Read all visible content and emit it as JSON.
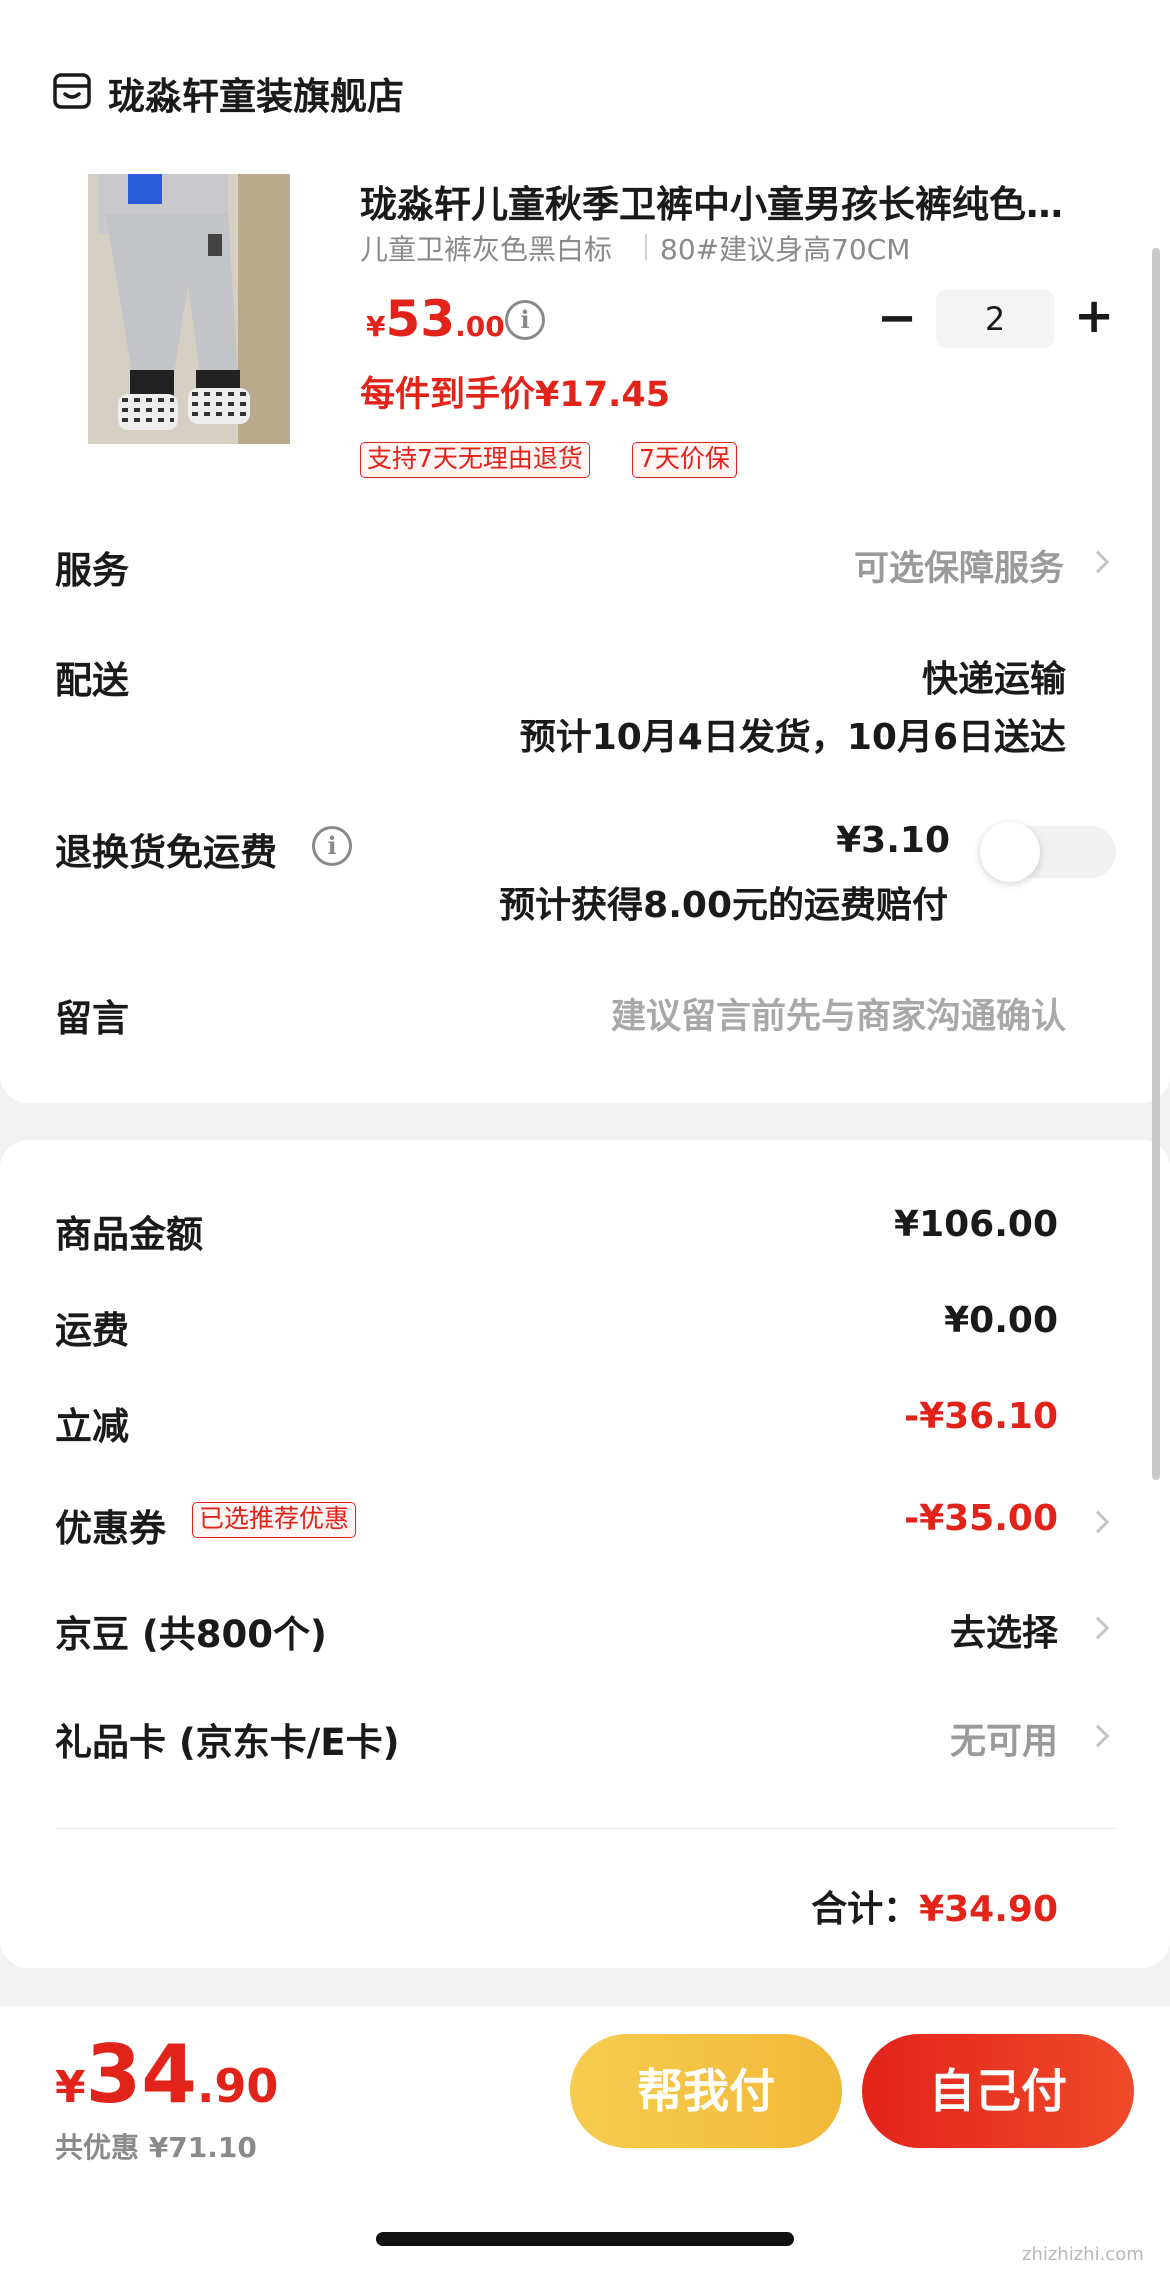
{
  "store": {
    "icon": "store-icon",
    "name": "珑淼轩童装旗舰店"
  },
  "product": {
    "title": "珑淼轩儿童秋季卫裤中小童男孩长裤纯色…",
    "spec_color": "儿童卫裤灰色黑白标",
    "spec_size": "80#建议身高70CM",
    "price_symbol": "¥",
    "price_int": "53",
    "price_dec": ".00",
    "unit_price": "每件到手价¥17.45",
    "quantity": "2",
    "minus": "−",
    "plus": "+",
    "tags": [
      "支持7天无理由退货",
      "7天价保"
    ]
  },
  "service": {
    "label": "服务",
    "value": "可选保障服务"
  },
  "delivery": {
    "label": "配送",
    "method": "快递运输",
    "estimate": "预计10月4日发货，10月6日送达"
  },
  "return_shipping": {
    "label": "退换货免运费",
    "price": "¥3.10",
    "note": "预计获得8.00元的运费赔付",
    "enabled": false
  },
  "message": {
    "label": "留言",
    "placeholder": "建议留言前先与商家沟通确认"
  },
  "summary": {
    "goods_label": "商品金额",
    "goods_value": "¥106.00",
    "shipping_label": "运费",
    "shipping_value": "¥0.00",
    "discount_label": "立减",
    "discount_value": "-¥36.10",
    "coupon_label": "优惠券",
    "coupon_tag": "已选推荐优惠",
    "coupon_value": "-¥35.00",
    "beans_label": "京豆 (共800个)",
    "beans_value": "去选择",
    "giftcard_label": "礼品卡 (京东卡/E卡)",
    "giftcard_value": "无可用",
    "total_label": "合计：",
    "total_value": "¥34.90"
  },
  "bottom": {
    "symbol": "¥",
    "int": "34",
    "dec": ".90",
    "saved": "共优惠 ¥71.10",
    "help_pay": "帮我付",
    "self_pay": "自己付"
  },
  "watermark": "zhizhizhi.com",
  "colors": {
    "accent_red": "#e2231a",
    "help_pay_yellow": "#f4bf43",
    "self_pay_red": "#e2231a"
  }
}
